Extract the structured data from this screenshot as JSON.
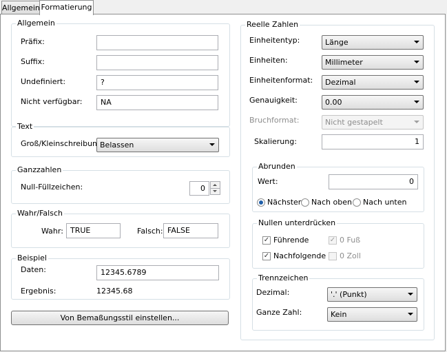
{
  "tabs": [
    {
      "label": "Allgemein"
    },
    {
      "label": "Formatierung"
    }
  ],
  "allgemein": {
    "title": "Allgemein",
    "praefix_label": "Präfix:",
    "praefix_value": "",
    "suffix_label": "Suffix:",
    "suffix_value": "",
    "undef_label": "Undefiniert:",
    "undef_value": "?",
    "nv_label": "Nicht verfügbar:",
    "nv_value": "NA"
  },
  "text": {
    "title": "Text",
    "gk_label": "Groß/Kleinschreibung:",
    "gk_value": "Belassen"
  },
  "ganzzahlen": {
    "title": "Ganzzahlen",
    "null_label": "Null-Füllzeichen:",
    "null_value": "0"
  },
  "wahrfalsch": {
    "title": "Wahr/Falsch",
    "wahr_label": "Wahr:",
    "wahr_value": "TRUE",
    "falsch_label": "Falsch:",
    "falsch_value": "FALSE"
  },
  "beispiel": {
    "title": "Beispiel",
    "daten_label": "Daten:",
    "daten_value": "12345.6789",
    "ergebnis_label": "Ergebnis:",
    "ergebnis_value": "12345.68"
  },
  "style_button": "Von Bemaßungsstil einstellen...",
  "reelle": {
    "title": "Reelle Zahlen",
    "einheitentyp_label": "Einheitentyp:",
    "einheitentyp_value": "Länge",
    "einheiten_label": "Einheiten:",
    "einheiten_value": "Millimeter",
    "format_label": "Einheitenformat:",
    "format_value": "Dezimal",
    "genau_label": "Genauigkeit:",
    "genau_value": "0.00",
    "bruch_label": "Bruchformat:",
    "bruch_value": "Nicht gestapelt",
    "skal_label": "Skalierung:",
    "skal_value": "1"
  },
  "abrunden": {
    "title": "Abrunden",
    "wert_label": "Wert:",
    "wert_value": "0",
    "radio_naechster": "Nächster",
    "radio_oben": "Nach oben",
    "radio_unten": "Nach unten"
  },
  "nullen": {
    "title": "Nullen unterdrücken",
    "fuehrende": "Führende",
    "nachfolgende": "Nachfolgende",
    "fuss": "0 Fuß",
    "zoll": "0 Zoll"
  },
  "trenn": {
    "title": "Trennzeichen",
    "dezimal_label": "Dezimal:",
    "dezimal_value": "'.' (Punkt)",
    "ganze_label": "Ganze Zahl:",
    "ganze_value": "Kein"
  }
}
